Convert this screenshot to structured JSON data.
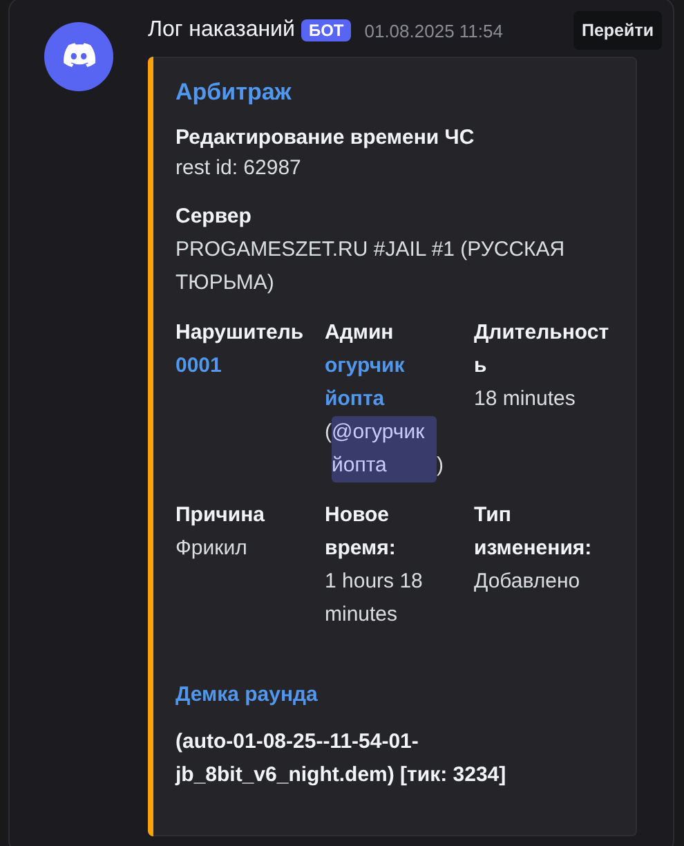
{
  "message": {
    "author": "Лог наказаний",
    "badge": "БОТ",
    "timestamp": "01.08.2025 11:54",
    "action_button": "Перейти"
  },
  "embed": {
    "color": "#f9a20e",
    "title": "Арбитраж",
    "description": [
      {
        "kind": "bold",
        "text": "Редактирование времени ЧС"
      },
      {
        "kind": "text",
        "text": "rest id: 62987"
      }
    ],
    "fields": [
      {
        "name": "Сервер",
        "inline": false,
        "value": [
          {
            "kind": "text",
            "text": "PROGAMESZET.RU #JAIL #1 (РУССКАЯ ТЮРЬМА)"
          }
        ]
      },
      {
        "name": "Нарушитель",
        "inline": true,
        "value": [
          {
            "kind": "link",
            "text": "0001"
          }
        ]
      },
      {
        "name": "Админ",
        "inline": true,
        "value": [
          {
            "kind": "link",
            "text": "огурчик йопта"
          },
          {
            "kind": "break"
          },
          {
            "kind": "text",
            "text": "("
          },
          {
            "kind": "mention",
            "text": "@огурчик йопта"
          },
          {
            "kind": "text",
            "text": ")"
          }
        ]
      },
      {
        "name": "Длительность",
        "inline": true,
        "value": [
          {
            "kind": "text",
            "text": "18 minutes"
          }
        ]
      },
      {
        "name": "Причина",
        "inline": true,
        "value": [
          {
            "kind": "text",
            "text": "Фрикил"
          }
        ]
      },
      {
        "name": "Новое время:",
        "inline": true,
        "value": [
          {
            "kind": "text",
            "text": "1 hours 18 minutes"
          }
        ]
      },
      {
        "name": "Тип изменения:",
        "inline": true,
        "value": [
          {
            "kind": "text",
            "text": "Добавлено"
          }
        ]
      }
    ],
    "demo": {
      "link": "Демка раунда",
      "text": "(auto-01-08-25--11-54-01-jb_8bit_v6_night.dem) [тик: 3234]"
    }
  }
}
